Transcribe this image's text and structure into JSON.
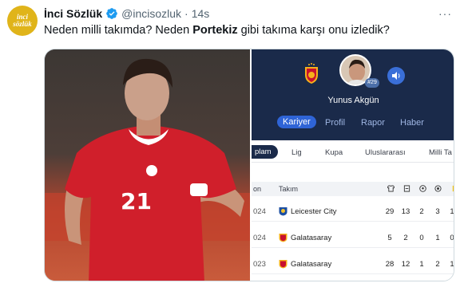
{
  "tweet": {
    "author_name": "İnci Sözlük",
    "handle": "@incisozluk",
    "separator": "·",
    "time": "14s",
    "text_parts": [
      "Neden milli takımda? Neden ",
      "Portekiz",
      " gibi takıma karşı onu izledik?"
    ],
    "more_label": "···",
    "avatar_text": [
      "inci",
      "sözlük"
    ]
  },
  "photo": {
    "jersey_number": "21",
    "accent_colors": {
      "jersey_red": "#d01f2b",
      "white": "#ffffff"
    }
  },
  "app_panel": {
    "player_name": "Yunus Akgün",
    "shirt_number": "#29",
    "main_tabs": [
      {
        "label": "Kariyer",
        "active": true
      },
      {
        "label": "Profil",
        "active": false
      },
      {
        "label": "Rapor",
        "active": false
      },
      {
        "label": "Haber",
        "active": false
      }
    ],
    "sub_tabs": [
      {
        "label": "plam",
        "active": true
      },
      {
        "label": "Lig",
        "active": false
      },
      {
        "label": "Kupa",
        "active": false
      },
      {
        "label": "Uluslararası",
        "active": false
      },
      {
        "label": "Milli Ta",
        "active": false
      }
    ],
    "table": {
      "headers": {
        "season": "on",
        "team": "Takım"
      },
      "header_icons": [
        "shirt-icon",
        "substitution-icon",
        "ball-icon",
        "assist-icon",
        "card-icon"
      ],
      "rows": [
        {
          "season": "024",
          "team": "Leicester City",
          "values": [
            "29",
            "13",
            "2",
            "3",
            "1"
          ]
        },
        {
          "season": "024",
          "team": "Galatasaray",
          "values": [
            "5",
            "2",
            "0",
            "1",
            "0"
          ]
        },
        {
          "season": "023",
          "team": "Galatasaray",
          "values": [
            "28",
            "12",
            "1",
            "2",
            "1"
          ]
        }
      ]
    },
    "colors": {
      "navy": "#1a2a4a",
      "blue_active": "#2f64d6"
    }
  }
}
